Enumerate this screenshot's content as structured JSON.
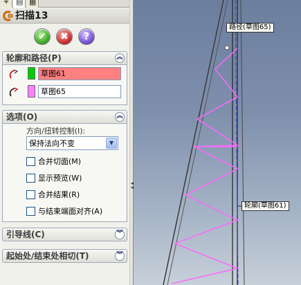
{
  "feature": {
    "title": "扫描13"
  },
  "actions": {
    "ok": "✔",
    "cancel": "✖",
    "help": "?"
  },
  "sections": {
    "profile_path": {
      "title": "轮廓和路径(P)",
      "profile_value": "草图61",
      "path_value": "草图65",
      "profile_color": "#ff8080",
      "profile_swatch": "#00cc00",
      "path_swatch": "#ff80ff"
    },
    "options": {
      "title": "选项(O)",
      "direction_label": "方向/扭转控制(I):",
      "direction_value": "保持法向不变",
      "checkboxes": [
        "合并切面(M)",
        "显示预览(W)",
        "合并结果(R)",
        "与结束端面对齐(A)"
      ]
    },
    "guide_curves": {
      "title": "引导线(C)"
    },
    "tangency": {
      "title": "起始处/结束处相切(T)"
    }
  },
  "viewport": {
    "path_label": "路径(草图65)",
    "profile_label": "轮廓(草图61)",
    "helix_color": "#ff66ff"
  }
}
